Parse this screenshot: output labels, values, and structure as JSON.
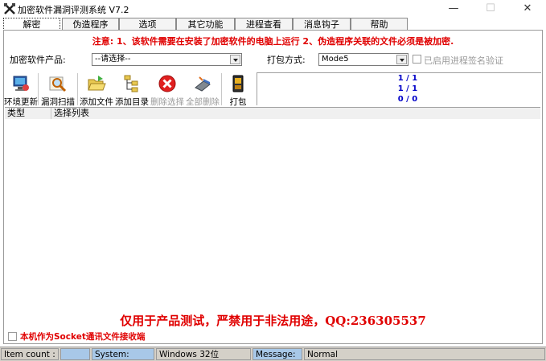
{
  "window": {
    "title": "加密软件漏洞评测系统  V7.2",
    "minimize": "—",
    "maximize": "☐",
    "close": "✕"
  },
  "tabs": [
    {
      "label": "解密",
      "active": true
    },
    {
      "label": "伪造程序",
      "active": false
    },
    {
      "label": "选项",
      "active": false
    },
    {
      "label": "其它功能",
      "active": false
    },
    {
      "label": "进程查看",
      "active": false
    },
    {
      "label": "消息钩子",
      "active": false
    },
    {
      "label": "帮助",
      "active": false
    }
  ],
  "notice": "注意: 1、该软件需要在安装了加密软件的电脑上运行  2、伪造程序关联的文件必须是被加密.",
  "form": {
    "product_label": "加密软件产品:",
    "product_value": "--请选择--",
    "pack_label": "打包方式:",
    "pack_value": "Mode5",
    "sign_check_label": "已启用进程签名验证"
  },
  "toolbar": {
    "env_update": "环境更新",
    "scan": "漏洞扫描",
    "add_file": "添加文件",
    "add_dir": "添加目录",
    "delete_sel": "删除选择",
    "delete_all": "全部删除",
    "pack": "打包"
  },
  "stats": [
    "1 / 1",
    "1 / 1",
    "0 / 0"
  ],
  "list": {
    "col_type": "类型",
    "col_items": "选择列表"
  },
  "warning": "仅用于产品测试，严禁用于非法用途，QQ:236305537",
  "socket_label": "本机作为Socket通讯文件接收端",
  "statusbar": {
    "item_count_label": "Item count :",
    "item_count_value": "",
    "system_label": "System:",
    "system_value": "Windows  32位",
    "message_label": "Message:",
    "message_value": "Normal"
  },
  "colors": {
    "notice_red": "#e00000",
    "stat_blue": "#0000c8",
    "status_blue": "#a8c8e8"
  }
}
